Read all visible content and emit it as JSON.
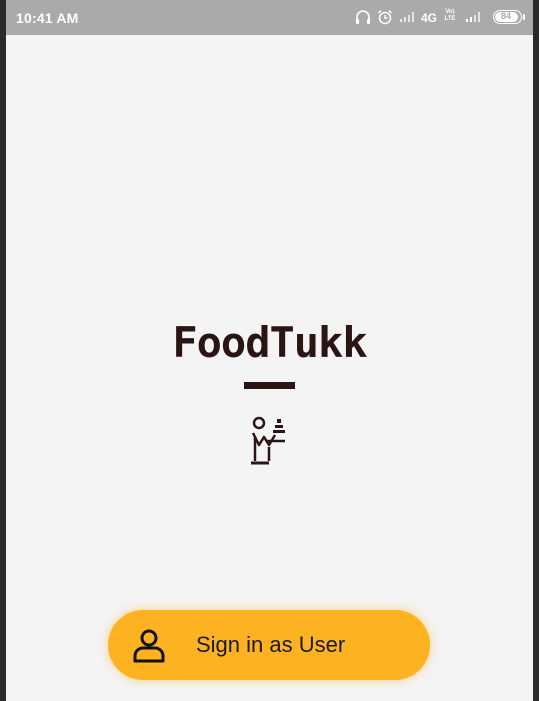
{
  "status_bar": {
    "time": "10:41 AM",
    "network": "4G",
    "volte_top": "Vo)",
    "volte_bottom": "LTE",
    "battery": "84",
    "icons": [
      "headphones-icon",
      "alarm-icon",
      "signal-icon",
      "volte-icon",
      "signal-icon",
      "battery-icon"
    ]
  },
  "app": {
    "title": "FoodTukk",
    "logo_icon": "waiter-icon"
  },
  "signin": {
    "label": "Sign in as User",
    "icon": "user-icon"
  },
  "colors": {
    "background": "#f4f4f4",
    "status_bar": "#aaaaaa",
    "brand_dark": "#2b1414",
    "button": "#fdb321"
  }
}
